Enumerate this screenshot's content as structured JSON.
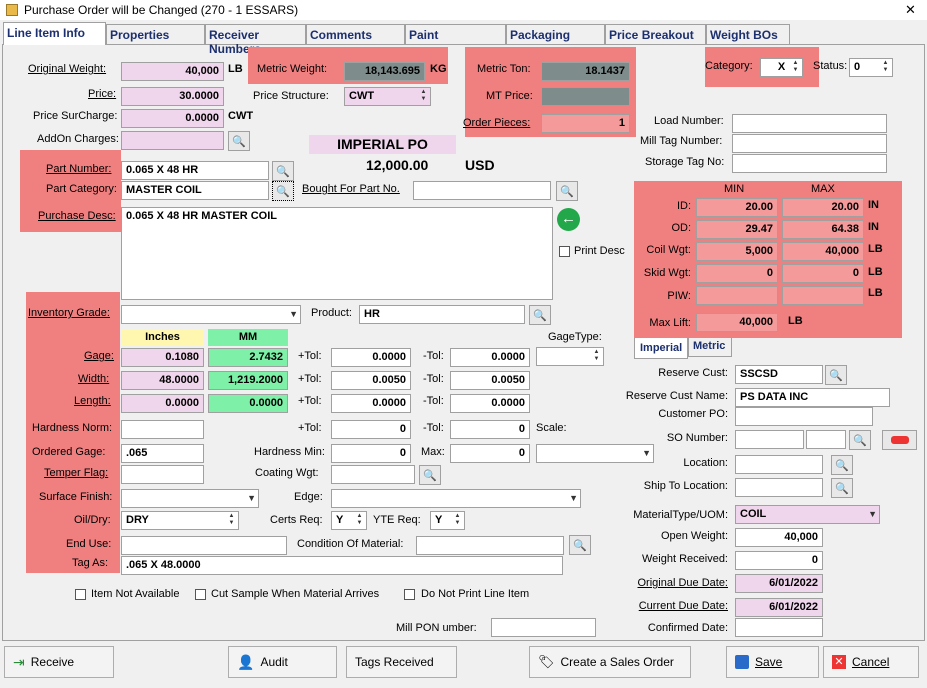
{
  "window": {
    "title": "Purchase Order will be Changed  (270 - 1  ESSARS)",
    "close": "✕"
  },
  "tabs": [
    "Line Item Info",
    "Properties",
    "Receiver Numbers",
    "Comments",
    "Paint",
    "Packaging",
    "Price Breakout",
    "Weight BOs"
  ],
  "top": {
    "orig_wt_label": "Original Weight:",
    "orig_wt": "40,000",
    "orig_wt_unit": "LB",
    "price_label": "Price:",
    "price": "30.0000",
    "surcharge_label": "Price SurCharge:",
    "surcharge": "0.0000",
    "surcharge_unit": "CWT",
    "addon_label": "AddOn Charges:",
    "metric_wt_label": "Metric Weight:",
    "metric_wt": "18,143.695",
    "metric_wt_unit": "KG",
    "price_struct_label": "Price Structure:",
    "price_struct": "CWT",
    "metric_ton_label": "Metric Ton:",
    "metric_ton": "18.1437",
    "mt_price_label": "MT Price:",
    "order_pieces_label": "Order Pieces:",
    "order_pieces": "1",
    "category_label": "Category:",
    "category": "X",
    "status_label": "Status:",
    "status": "0",
    "imperial_po": "IMPERIAL PO",
    "po_amount": "12,000.00",
    "po_currency": "USD"
  },
  "load": {
    "load_label": "Load Number:",
    "mill_tag_label": "Mill Tag Number:",
    "storage_label": "Storage Tag No:"
  },
  "part": {
    "part_number_label": "Part Number:",
    "part_number": "0.065 X 48 HR",
    "category_label": "Part Category:",
    "category": "MASTER COIL",
    "bought_label": "Bought For Part No.",
    "desc_label": "Purchase Desc:",
    "desc": "0.065 X 48 HR MASTER COIL",
    "print_desc": "Print Desc"
  },
  "dims": {
    "min": "MIN",
    "max": "MAX",
    "id_label": "ID:",
    "id_min": "20.00",
    "id_max": "20.00",
    "id_unit": "IN",
    "od_label": "OD:",
    "od_min": "29.47",
    "od_max": "64.38",
    "od_unit": "IN",
    "coil_label": "Coil Wgt:",
    "coil_min": "5,000",
    "coil_max": "40,000",
    "coil_unit": "LB",
    "skid_label": "Skid Wgt:",
    "skid_min": "0",
    "skid_max": "0",
    "skid_unit": "LB",
    "piw_label": "PIW:",
    "piw_unit": "LB",
    "maxlift_label": "Max Lift:",
    "maxlift": "40,000",
    "maxlift_unit": "LB",
    "tab_imperial": "Imperial",
    "tab_metric": "Metric"
  },
  "spec": {
    "inv_grade_label": "Inventory Grade:",
    "product_label": "Product:",
    "product": "HR",
    "inches": "Inches",
    "mm": "MM",
    "gage_type_label": "GageType:",
    "gage_label": "Gage:",
    "gage_in": "0.1080",
    "gage_mm": "2.7432",
    "gage_ptol": "0.0000",
    "gage_mtol": "0.0000",
    "width_label": "Width:",
    "width_in": "48.0000",
    "width_mm": "1,219.2000",
    "width_ptol": "0.0050",
    "width_mtol": "0.0050",
    "length_label": "Length:",
    "length_in": "0.0000",
    "length_mm": "0.0000",
    "length_ptol": "0.0000",
    "length_mtol": "0.0000",
    "ptol": "+Tol:",
    "mtol": "-Tol:",
    "hard_norm_label": "Hardness Norm:",
    "hard_ptol": "0",
    "hard_mtol": "0",
    "scale_label": "Scale:",
    "ord_gage_label": "Ordered Gage:",
    "ord_gage": ".065",
    "hard_min_label": "Hardness Min:",
    "hard_min": "0",
    "max_label": "Max:",
    "hard_max": "0",
    "temper_label": "Temper Flag:",
    "coating_label": "Coating Wgt:",
    "surface_label": "Surface Finish:",
    "edge_label": "Edge:",
    "oil_label": "Oil/Dry:",
    "oil": "DRY",
    "certs_label": "Certs Req:",
    "certs": "Y",
    "yte_label": "YTE Req:",
    "yte": "Y",
    "end_use_label": "End Use:",
    "condition_label": "Condition Of Material:",
    "tag_as_label": "Tag As:",
    "tag_as": ".065 X 48.0000"
  },
  "cust": {
    "reserve_label": "Reserve Cust:",
    "reserve": "SSCSD",
    "reserve_name_label": "Reserve Cust Name:",
    "reserve_name": "PS DATA INC",
    "customer_po_label": "Customer PO:",
    "so_label": "SO Number:",
    "location_label": "Location:",
    "ship_label": "Ship To Location:",
    "mat_label": "MaterialType/UOM:",
    "mat": "COIL",
    "open_wt_label": "Open Weight:",
    "open_wt": "40,000",
    "wt_recv_label": "Weight Received:",
    "wt_recv": "0",
    "orig_due_label": "Original Due Date:",
    "orig_due": "6/01/2022",
    "cur_due_label": "Current Due Date:",
    "cur_due": "6/01/2022",
    "conf_label": "Confirmed Date:"
  },
  "checks": {
    "not_avail": "Item Not Available",
    "cut_sample": "Cut Sample When Material Arrives",
    "no_print": "Do Not Print Line Item"
  },
  "mill_pon_label": "Mill PON umber:",
  "buttons": {
    "receive": "Receive",
    "audit": "Audit",
    "tags": "Tags Received",
    "create_so": "Create a Sales Order",
    "save": "Save",
    "cancel": "Cancel"
  }
}
